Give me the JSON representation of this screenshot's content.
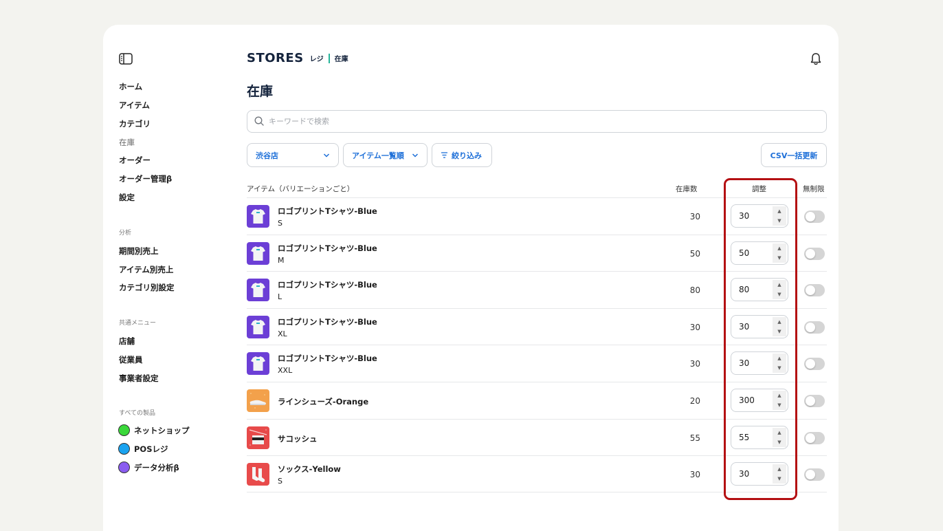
{
  "brand": {
    "logo": "STORES",
    "product": "レジ",
    "section": "在庫"
  },
  "page": {
    "title": "在庫"
  },
  "sidebar": {
    "main_items": [
      {
        "label": "ホーム"
      },
      {
        "label": "アイテム"
      },
      {
        "label": "カテゴリ"
      },
      {
        "label": "在庫"
      },
      {
        "label": "オーダー"
      },
      {
        "label": "オーダー管理β"
      },
      {
        "label": "設定"
      }
    ],
    "analysis_title": "分析",
    "analysis_items": [
      {
        "label": "期間別売上"
      },
      {
        "label": "アイテム別売上"
      },
      {
        "label": "カテゴリ別設定"
      }
    ],
    "common_title": "共通メニュー",
    "common_items": [
      {
        "label": "店舗"
      },
      {
        "label": "従業員"
      },
      {
        "label": "事業者設定"
      }
    ],
    "products_title": "すべての製品",
    "products": [
      {
        "label": "ネットショップ",
        "color": "#3ad83a"
      },
      {
        "label": "POSレジ",
        "color": "#1aa3f0"
      },
      {
        "label": "データ分析β",
        "color": "#8a5cf0"
      }
    ]
  },
  "search": {
    "placeholder": "キーワードで検索"
  },
  "filters": {
    "store": "渋谷店",
    "sort": "アイテム一覧順",
    "filter": "絞り込み",
    "csv_update": "CSV一括更新"
  },
  "table": {
    "headers": {
      "item": "アイテム（バリエーションごと）",
      "stock": "在庫数",
      "adjust": "調整",
      "unlimited": "無制限"
    },
    "rows": [
      {
        "name": "ロゴプリントTシャツ-Blue",
        "variant": "S",
        "stock": "30",
        "adjust": "30",
        "thumb": "tshirt"
      },
      {
        "name": "ロゴプリントTシャツ-Blue",
        "variant": "M",
        "stock": "50",
        "adjust": "50",
        "thumb": "tshirt"
      },
      {
        "name": "ロゴプリントTシャツ-Blue",
        "variant": "L",
        "stock": "80",
        "adjust": "80",
        "thumb": "tshirt"
      },
      {
        "name": "ロゴプリントTシャツ-Blue",
        "variant": "XL",
        "stock": "30",
        "adjust": "30",
        "thumb": "tshirt"
      },
      {
        "name": "ロゴプリントTシャツ-Blue",
        "variant": "XXL",
        "stock": "30",
        "adjust": "30",
        "thumb": "tshirt"
      },
      {
        "name": "ラインシューズ-Orange",
        "variant": "",
        "stock": "20",
        "adjust": "300",
        "thumb": "shoes"
      },
      {
        "name": "サコッシュ",
        "variant": "",
        "stock": "55",
        "adjust": "55",
        "thumb": "sacoche"
      },
      {
        "name": "ソックス-Yellow",
        "variant": "S",
        "stock": "30",
        "adjust": "30",
        "thumb": "socks"
      }
    ]
  },
  "colors": {
    "accent": "#1d6fd8",
    "highlight": "#b40f12",
    "brand_bar": "#26b59a"
  }
}
